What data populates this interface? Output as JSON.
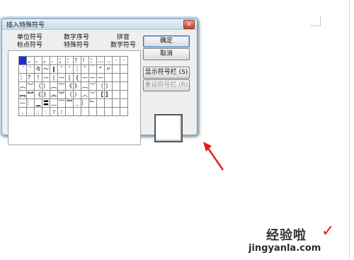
{
  "dialog": {
    "title": "插入特殊符号",
    "close_glyph": "✕",
    "tabs": {
      "back": [
        "单位符号",
        "数字序号",
        "拼音"
      ],
      "front": [
        "标点符号",
        "特殊符号",
        "数学符号"
      ]
    },
    "symbols": [
      [
        "",
        "，",
        "、",
        "。",
        "．",
        "；",
        "：",
        "？",
        "！",
        "：",
        "…",
        "‥",
        "·",
        "·"
      ],
      [
        "ˊ",
        "ˋ",
        "々",
        "～",
        "‖",
        "ˇ",
        "ˉ",
        "｜",
        "＇",
        "｀",
        "\"",
        "〃",
        "",
        ""
      ],
      [
        "：",
        "？",
        "!",
        "—",
        "|",
        "—",
        "|",
        "{",
        "—",
        "—",
        "—",
        "",
        "",
        ""
      ],
      [
        "︵",
        "︶",
        "（",
        "）",
        "︷",
        "︸",
        "《",
        "》",
        "︹",
        "︺",
        "〔",
        "〕",
        "",
        ""
      ],
      [
        "︻",
        "︼",
        "《",
        "》",
        "︽",
        "︾",
        "〈",
        "〉",
        "︿",
        "﹀",
        "【",
        "】",
        "",
        ""
      ],
      [
        "—",
        "︳",
        "▁",
        "〓",
        "﹏",
        "﹋",
        "﹌",
        "﹍",
        "︴",
        "﹂",
        "",
        "",
        "",
        ""
      ],
      [
        "﹑",
        "﹒",
        "﹔",
        "﹕",
        "﹖",
        "﹗",
        "",
        "",
        "",
        "",
        "",
        "",
        "",
        ""
      ]
    ],
    "buttons": {
      "ok": "确定",
      "cancel": "取消",
      "show_toolbar": "显示符号栏 (S)",
      "reset_toolbar": "重设符号栏 (R)"
    }
  },
  "watermark": {
    "brand": "经验啦",
    "check": "✓",
    "url": "jingyanla.com"
  }
}
